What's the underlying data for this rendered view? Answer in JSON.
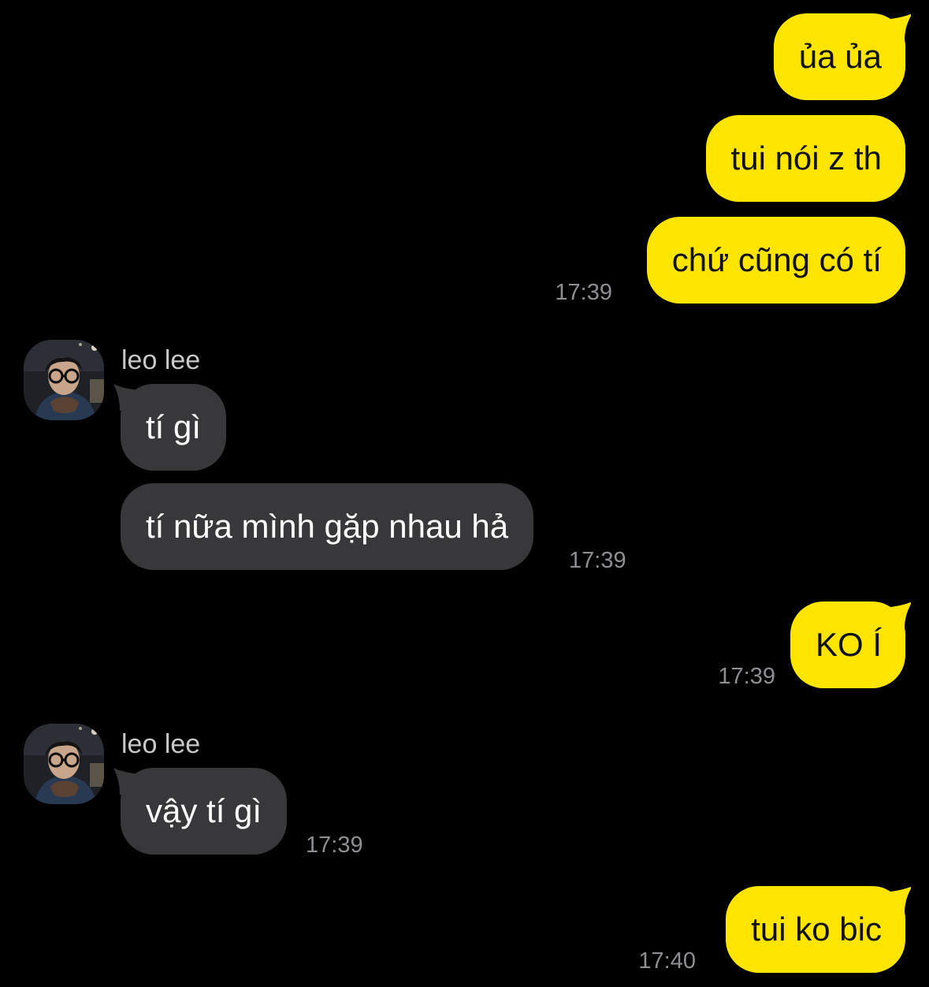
{
  "colors": {
    "background": "#000000",
    "outgoing_bubble": "#FEE500",
    "incoming_bubble": "#38383A",
    "timestamp": "#8E8E93",
    "sender_name": "#C8C8C8"
  },
  "messages": [
    {
      "direction": "outgoing",
      "text": "ủa ủa"
    },
    {
      "direction": "outgoing",
      "text": "tui nói z th"
    },
    {
      "direction": "outgoing",
      "text": "chứ cũng có tí",
      "time": "17:39"
    },
    {
      "direction": "incoming",
      "sender": "leo lee",
      "avatar_icon": "profile-photo",
      "text": "tí gì"
    },
    {
      "direction": "incoming",
      "text": "tí nữa mình gặp nhau hả",
      "time": "17:39"
    },
    {
      "direction": "outgoing",
      "text": "KO Í",
      "time": "17:39"
    },
    {
      "direction": "incoming",
      "sender": "leo lee",
      "avatar_icon": "profile-photo",
      "text": "vậy tí gì",
      "time": "17:39"
    },
    {
      "direction": "outgoing",
      "text": "tui ko bic",
      "time": "17:40"
    }
  ]
}
